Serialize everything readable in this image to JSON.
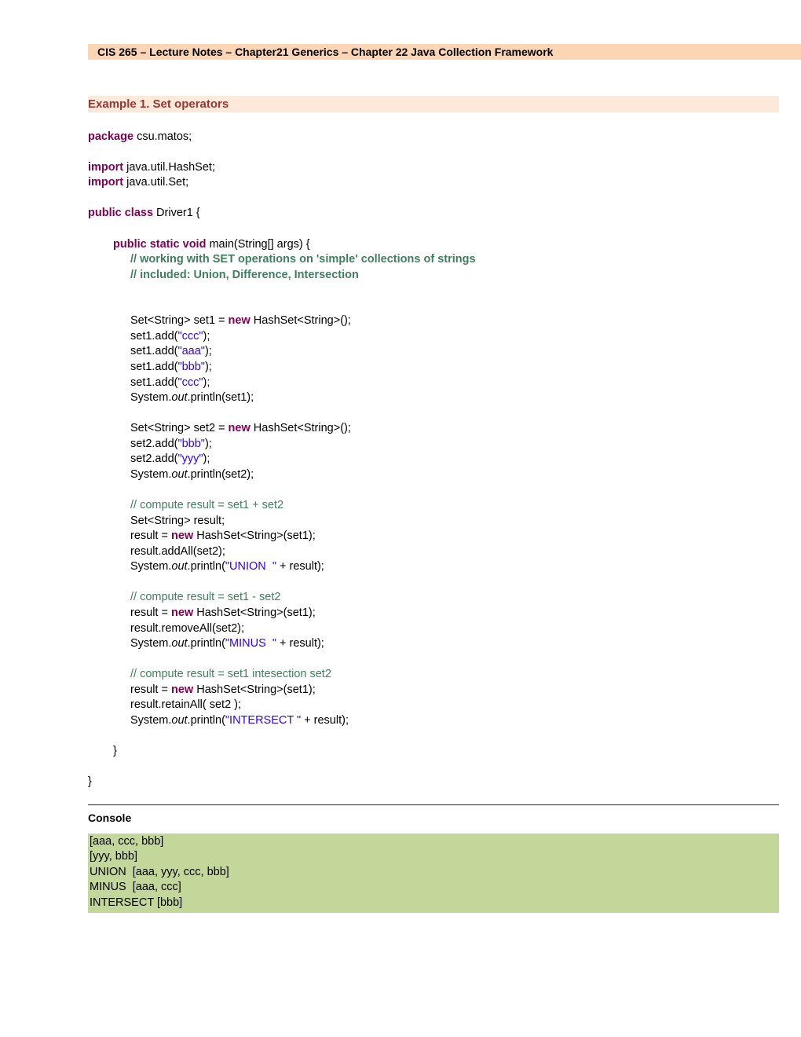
{
  "header": "CIS 265 – Lecture Notes – Chapter21 Generics – Chapter 22 Java Collection Framework",
  "example_title": "Example 1. Set operators",
  "code": {
    "kw_package": "package",
    "pkg": " csu.matos;",
    "kw_import": "import",
    "imp1": " java.util.HashSet;",
    "imp2": " java.util.Set;",
    "kw_public_class": "public class",
    "classline": " Driver1 {",
    "kw_psvm": "public static void",
    "main_sig": " main(String[] args) {",
    "c1": "// working with SET operations on 'simple' collections of strings",
    "c2": "// included: Union, Difference, Intersection",
    "l_set1_decl_a": "Set<String> set1 = ",
    "kw_new": "new",
    "l_set1_decl_b": " HashSet<String>();",
    "l_add_open": "set1.add(",
    "str_ccc": "\"ccc\"",
    "str_aaa": "\"aaa\"",
    "str_bbb": "\"bbb\"",
    "close_paren": ");",
    "sys": "System.",
    "out": "out",
    "println_set1": ".println(set1);",
    "l_set2_decl_a": "Set<String> set2 = ",
    "l_set2_decl_b": " HashSet<String>();",
    "l_set2_add_open": "set2.add(",
    "str_yyy": "\"yyy\"",
    "println_set2": ".println(set2);",
    "cm_union": "// compute result = set1 + set2",
    "l_result_decl": "Set<String> result;",
    "l_result_assign_a": "result = ",
    "l_result_assign_b": " HashSet<String>(set1);",
    "l_addall": "result.addAll(set2);",
    "println_open": ".println(",
    "str_union": "\"UNION  \"",
    "plus_result": " + result);",
    "cm_minus": "// compute result = set1 - set2",
    "l_removeall": "result.removeAll(set2);",
    "str_minus": "\"MINUS  \"",
    "cm_inter": "// compute result = set1 intesection set2",
    "l_retainall": "result.retainAll( set2 );",
    "str_inter": "\"INTERSECT \"",
    "brace_close": "}",
    "brace_close2": "}"
  },
  "console_label": "Console",
  "console": {
    "l1": "[aaa, ccc, bbb]",
    "l2": "[yyy, bbb]",
    "l3": "UNION  [aaa, yyy, ccc, bbb]",
    "l4": "MINUS  [aaa, ccc]",
    "l5": "INTERSECT [bbb]"
  }
}
